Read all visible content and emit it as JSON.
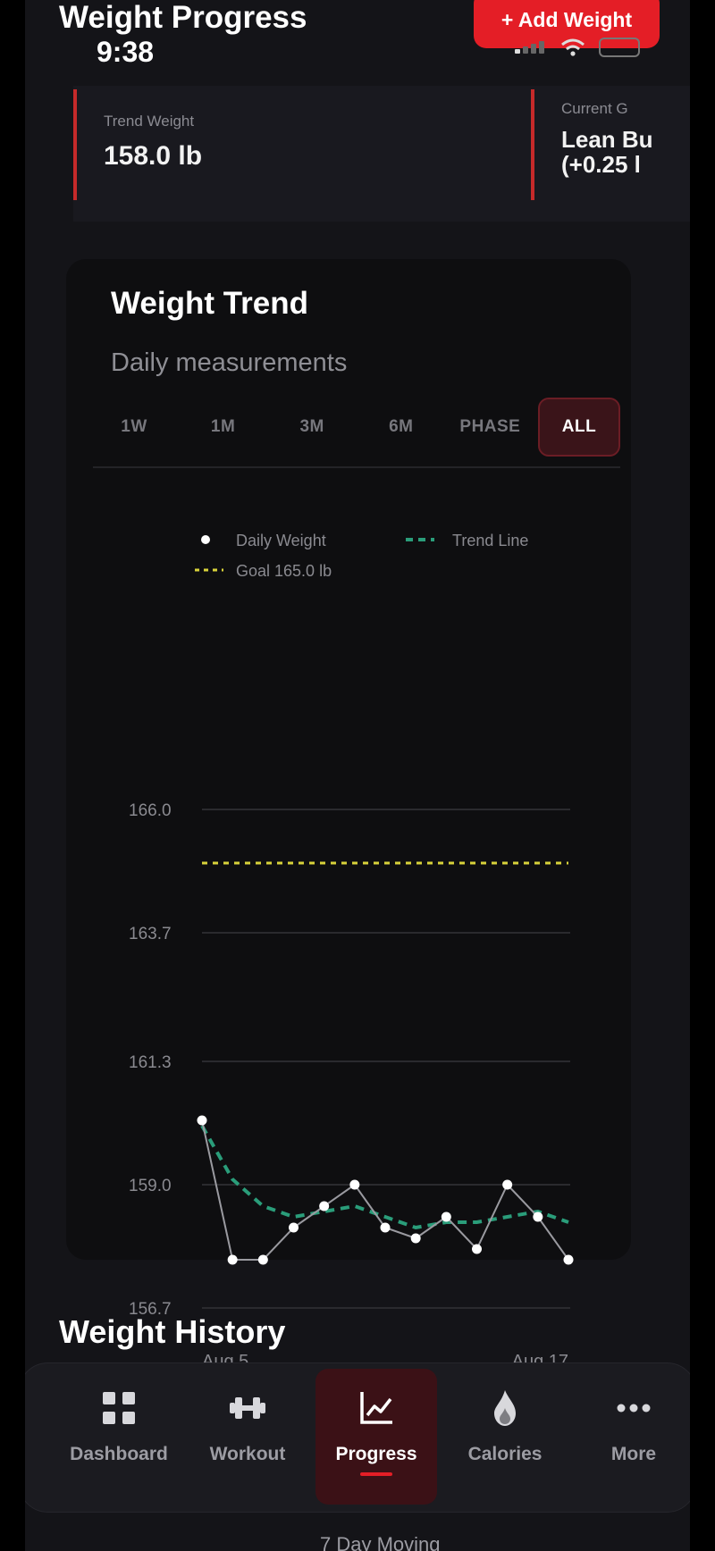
{
  "header": {
    "title": "Weight Progress",
    "add_button": "+ Add Weight",
    "status_time": "9:38"
  },
  "summary": {
    "trend_label": "Trend Weight",
    "trend_value": "158.0 lb",
    "goal_label": "Current G",
    "goal_value": "Lean Bu\n(+0.25 l"
  },
  "trend": {
    "title": "Weight Trend",
    "subtitle": "Daily measurements",
    "ranges": [
      "1W",
      "1M",
      "3M",
      "6M",
      "PHASE",
      "ALL"
    ],
    "active_range": "ALL"
  },
  "chart_data": {
    "type": "line",
    "legend": [
      "Daily Weight",
      "Trend Line",
      "Goal 165.0 lb"
    ],
    "y_ticks": [
      "166.0",
      "163.7",
      "161.3",
      "159.0",
      "156.7"
    ],
    "ylim": [
      156.7,
      166.0
    ],
    "x_labels": [
      "Aug 5",
      "Aug 17"
    ],
    "x": [
      "Aug 5",
      "Aug 6",
      "Aug 7",
      "Aug 8",
      "Aug 9",
      "Aug 10",
      "Aug 11",
      "Aug 12",
      "Aug 13",
      "Aug 14",
      "Aug 15",
      "Aug 16",
      "Aug 17"
    ],
    "series": [
      {
        "name": "Daily Weight",
        "values": [
          160.2,
          157.6,
          157.6,
          158.2,
          158.6,
          159.0,
          158.2,
          158.0,
          158.4,
          157.8,
          159.0,
          158.4,
          157.6
        ]
      },
      {
        "name": "Trend Line",
        "values": [
          160.1,
          159.1,
          158.6,
          158.4,
          158.5,
          158.6,
          158.4,
          158.2,
          158.3,
          158.3,
          158.4,
          158.5,
          158.3
        ]
      }
    ],
    "goal": 165.0,
    "colors": {
      "daily": "#ffffff",
      "trend": "#2a9d7a",
      "goal": "#d8d23a",
      "grid": "#2a2a2e",
      "tick": "#8a8a90"
    },
    "grid": true,
    "legend_position": "top-left"
  },
  "history": {
    "title": "Weight History"
  },
  "tabs": [
    {
      "label": "Dashboard",
      "icon": "grid-icon"
    },
    {
      "label": "Workout",
      "icon": "dumbbell-icon"
    },
    {
      "label": "Progress",
      "icon": "chart-icon"
    },
    {
      "label": "Calories",
      "icon": "flame-icon"
    },
    {
      "label": "More",
      "icon": "more-icon"
    }
  ],
  "footer_peek": "7 Day Moving"
}
